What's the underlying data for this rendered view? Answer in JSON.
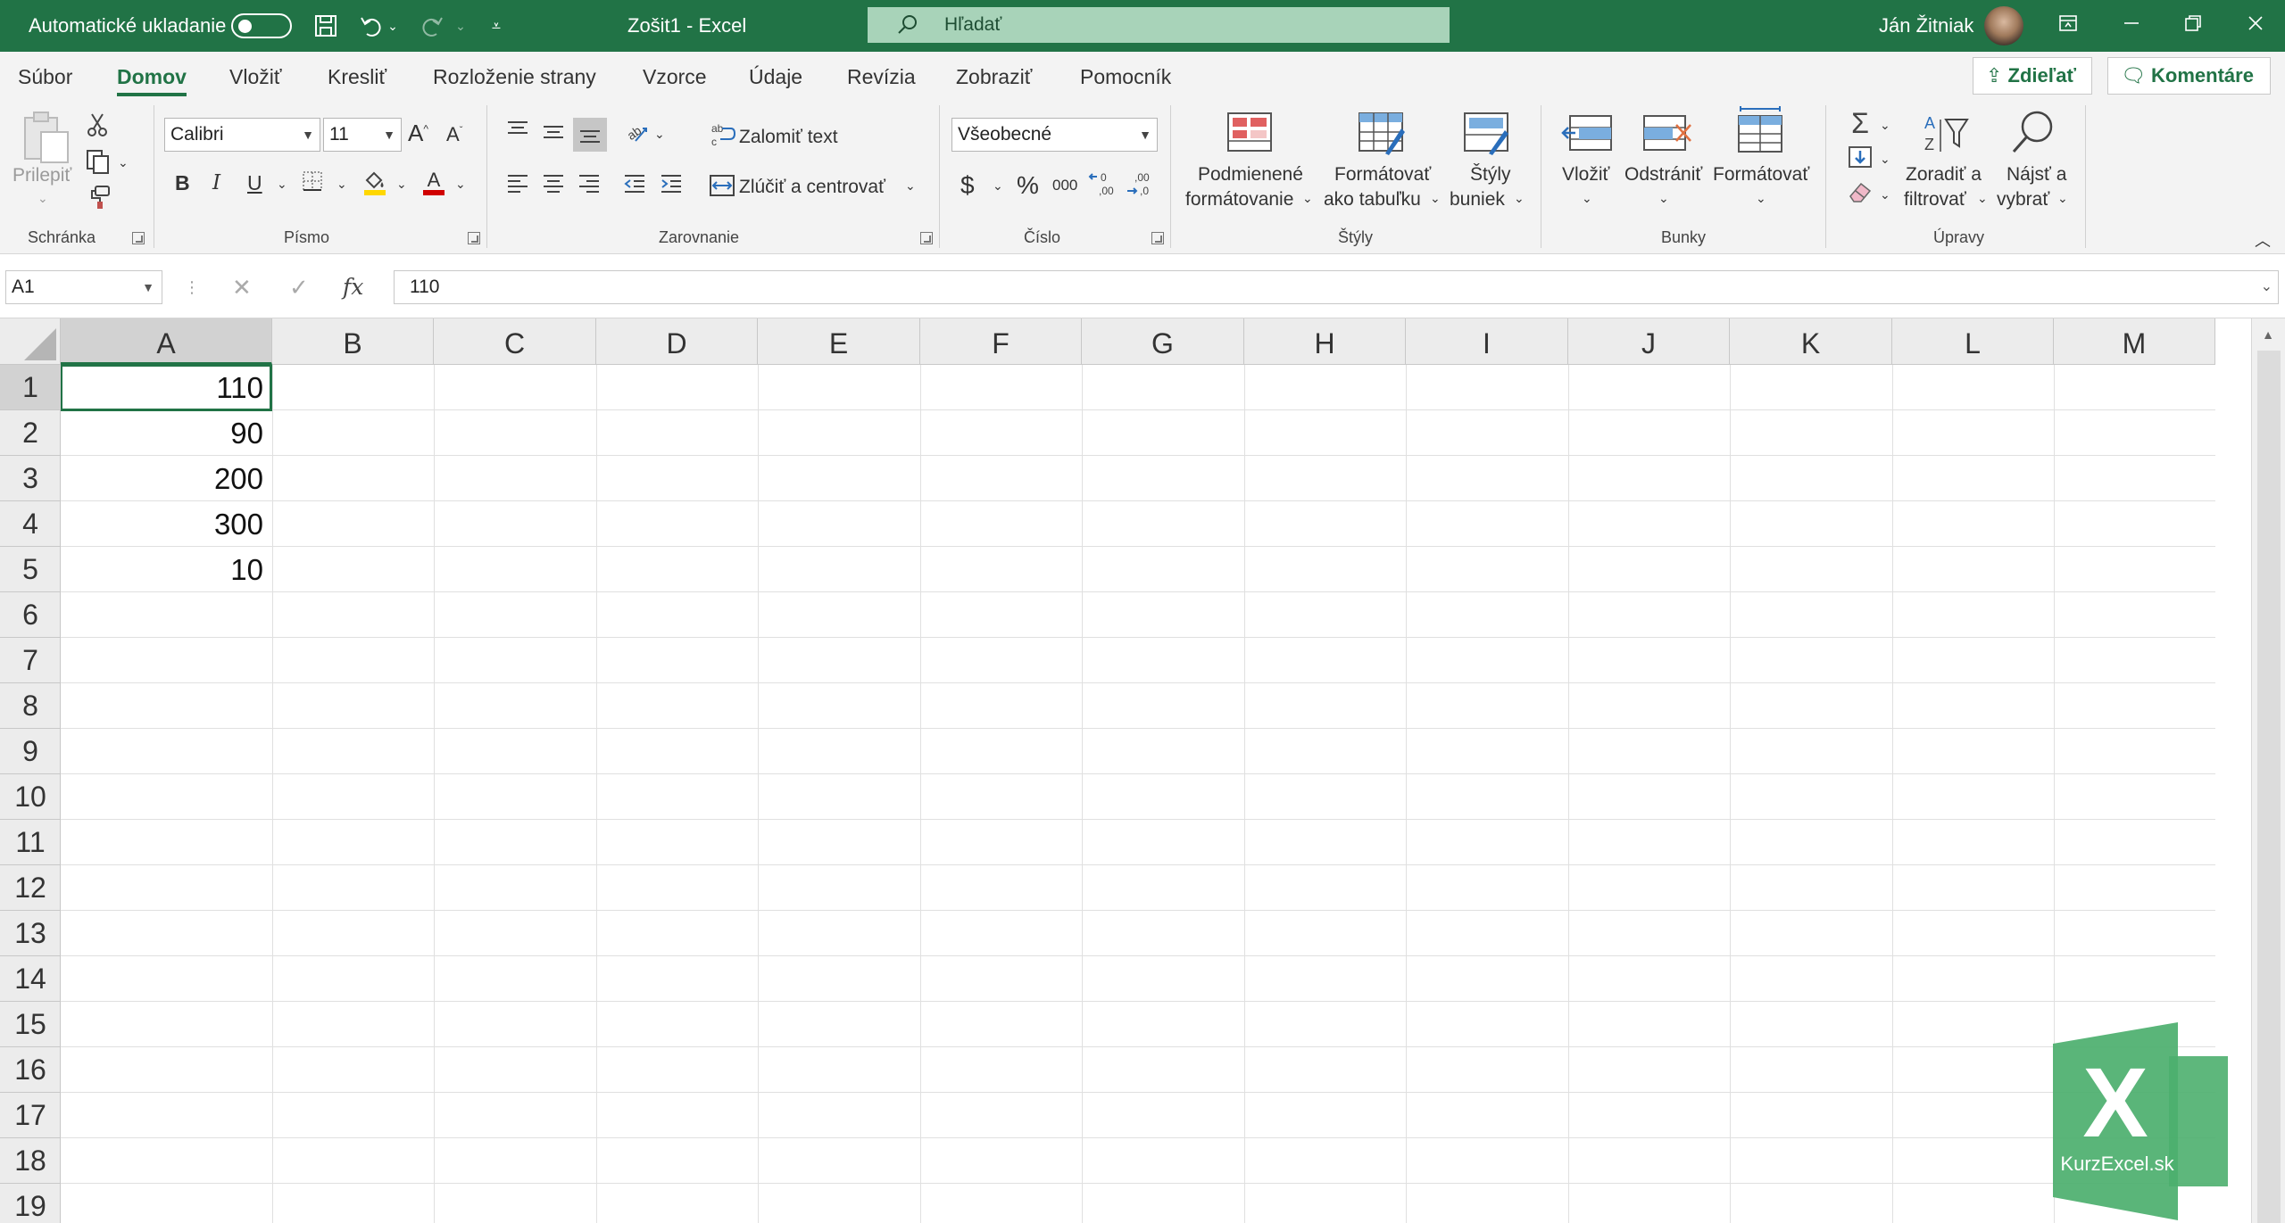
{
  "titlebar": {
    "autosave_label": "Automatické ukladanie",
    "doc_title": "Zošit1  -  Excel",
    "search_placeholder": "Hľadať",
    "user_name": "Ján Žitniak"
  },
  "menu": {
    "tabs": [
      "Súbor",
      "Domov",
      "Vložiť",
      "Kresliť",
      "Rozloženie strany",
      "Vzorce",
      "Údaje",
      "Revízia",
      "Zobraziť",
      "Pomocník"
    ],
    "active": "Domov",
    "share_label": "Zdieľať",
    "comments_label": "Komentáre"
  },
  "ribbon": {
    "clipboard": {
      "paste_label": "Prilepiť",
      "group_label": "Schránka"
    },
    "font": {
      "font_name": "Calibri",
      "font_size": "11",
      "bold": "B",
      "italic": "I",
      "underline": "U",
      "group_label": "Písmo"
    },
    "alignment": {
      "wrap_text": "Zalomiť text",
      "merge_center": "Zlúčiť a centrovať",
      "group_label": "Zarovnanie"
    },
    "number": {
      "format": "Všeobecné",
      "currency": "$",
      "percent": "%",
      "thousands": "000",
      "group_label": "Číslo"
    },
    "styles": {
      "conditional_line1": "Podmienené",
      "conditional_line2": "formátovanie",
      "table_line1": "Formátovať",
      "table_line2": "ako tabuľku",
      "cellstyles_line1": "Štýly",
      "cellstyles_line2": "buniek",
      "group_label": "Štýly"
    },
    "cells": {
      "insert": "Vložiť",
      "delete": "Odstrániť",
      "format": "Formátovať",
      "group_label": "Bunky"
    },
    "editing": {
      "sort_line1": "Zoradiť a",
      "sort_line2": "filtrovať",
      "find_line1": "Nájsť a",
      "find_line2": "vybrať",
      "group_label": "Úpravy"
    }
  },
  "formula_bar": {
    "name_box": "A1",
    "fx": "fx",
    "formula": "110"
  },
  "sheet": {
    "columns": [
      "A",
      "B",
      "C",
      "D",
      "E",
      "F",
      "G",
      "H",
      "I",
      "J",
      "K",
      "L",
      "M"
    ],
    "rows": [
      "1",
      "2",
      "3",
      "4",
      "5",
      "6",
      "7",
      "8",
      "9",
      "10",
      "11",
      "12",
      "13",
      "14",
      "15",
      "16",
      "17",
      "18",
      "19"
    ],
    "column_a_values": [
      "110",
      "90",
      "200",
      "300",
      "10"
    ],
    "active_cell": "A1"
  },
  "watermark": {
    "letter": "X",
    "text": "KurzExcel.sk"
  },
  "colors": {
    "brand_green": "#217346",
    "search_bg": "#a8d3b9",
    "ribbon_bg": "#f3f3f3",
    "gridline": "#e0e0e0",
    "logo_green": "#4caf6e"
  }
}
